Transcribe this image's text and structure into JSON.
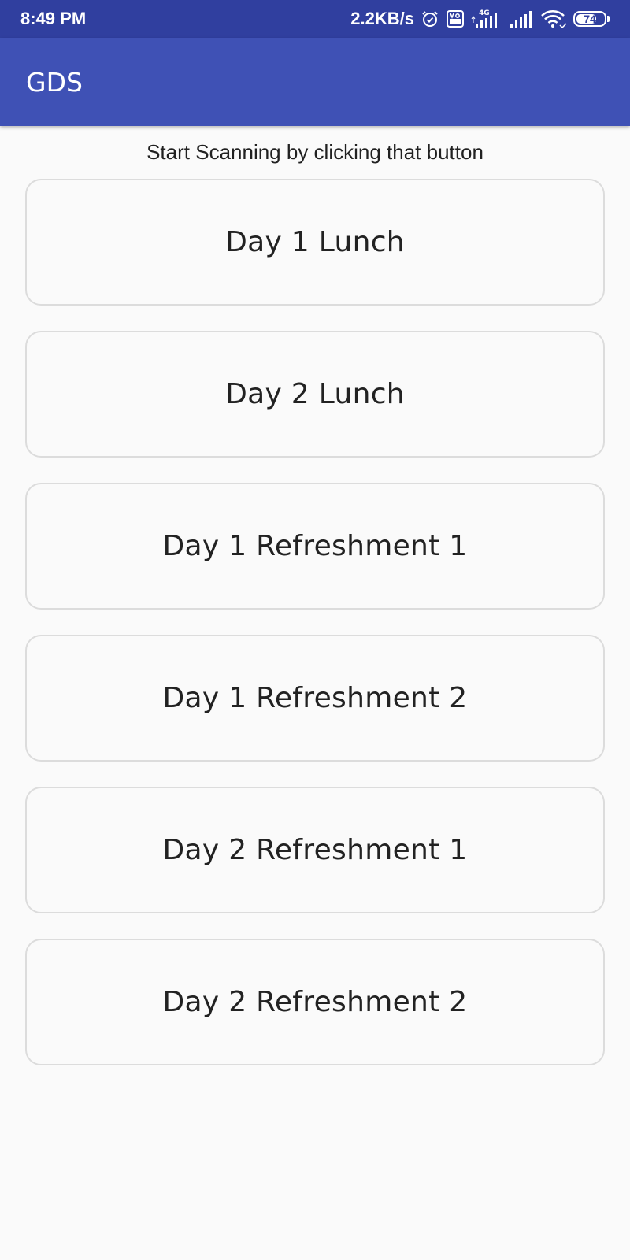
{
  "status_bar": {
    "time": "8:49 PM",
    "net_speed": "2.2KB/s",
    "icons": [
      "alarm-icon",
      "volte-icon",
      "signal-4g-icon",
      "signal-icon",
      "wifi-icon",
      "battery-icon"
    ],
    "volte_text": "Vo LTE",
    "network_type": "4G",
    "battery_level": "74",
    "battery_fraction": 0.74
  },
  "app_bar": {
    "title": "GDS"
  },
  "main": {
    "instruction": "Start Scanning by clicking that button",
    "buttons": [
      {
        "label": "Day 1 Lunch"
      },
      {
        "label": "Day 2 Lunch"
      },
      {
        "label": "Day 1 Refreshment 1"
      },
      {
        "label": "Day 1 Refreshment 2"
      },
      {
        "label": "Day 2 Refreshment 1"
      },
      {
        "label": "Day 2 Refreshment 2"
      }
    ]
  },
  "colors": {
    "status_bar": "#303f9f",
    "app_bar": "#3f51b5",
    "background": "#fafafa",
    "button_border": "#dcdcdc"
  }
}
